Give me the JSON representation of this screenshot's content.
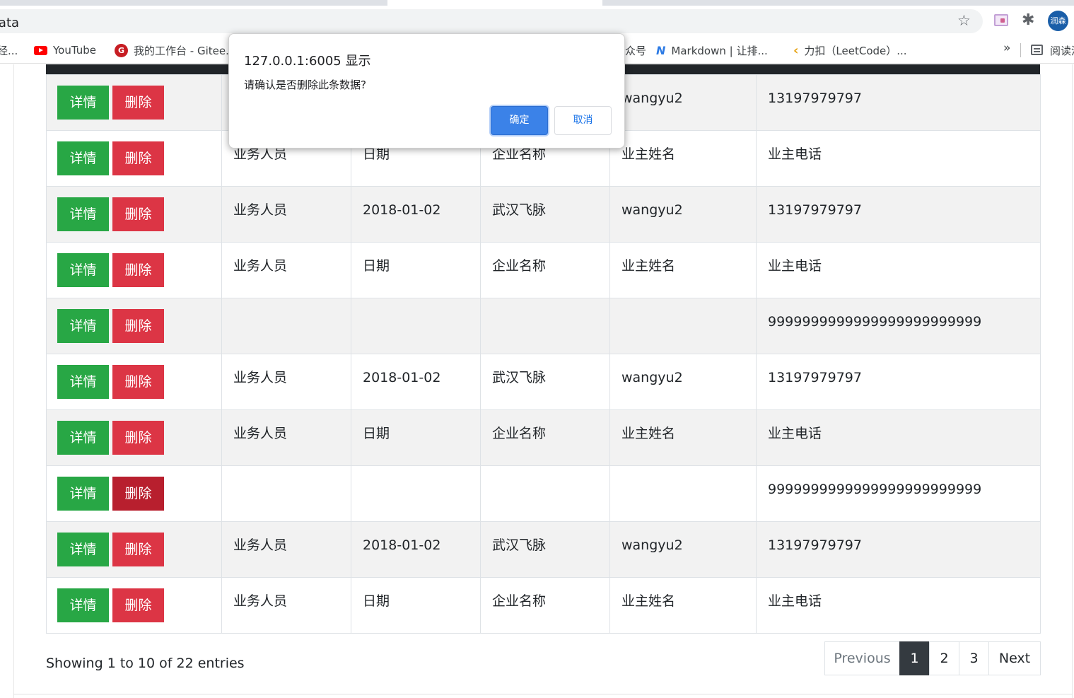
{
  "browser": {
    "url": "-data",
    "avatar_text": "润森",
    "bookmarks": [
      {
        "label": "经..."
      },
      {
        "label": "YouTube"
      },
      {
        "label": "我的工作台 - Gitee."
      },
      {
        "label": "众号"
      },
      {
        "label": "Markdown | 让排..."
      },
      {
        "label": "力扣（LeetCode）..."
      }
    ],
    "more_bookmarks": "»",
    "reading_list": "阅读清"
  },
  "dialog": {
    "title": "127.0.0.1:6005 显示",
    "message": "请确认是否删除此条数据?",
    "ok_label": "确定",
    "cancel_label": "取消"
  },
  "table": {
    "detail_label": "详情",
    "delete_label": "删除",
    "rows": [
      [
        "",
        "",
        "",
        "wangyu2",
        "13197979797"
      ],
      [
        "业务人员",
        "日期",
        "企业名称",
        "业主姓名",
        "业主电话"
      ],
      [
        "业务人员",
        "2018-01-02",
        "武汉飞脉",
        "wangyu2",
        "13197979797"
      ],
      [
        "业务人员",
        "日期",
        "企业名称",
        "业主姓名",
        "业主电话"
      ],
      [
        "",
        "",
        "",
        "",
        "9999999999999999999999999"
      ],
      [
        "业务人员",
        "2018-01-02",
        "武汉飞脉",
        "wangyu2",
        "13197979797"
      ],
      [
        "业务人员",
        "日期",
        "企业名称",
        "业主姓名",
        "业主电话"
      ],
      [
        "",
        "",
        "",
        "",
        "9999999999999999999999999"
      ],
      [
        "业务人员",
        "2018-01-02",
        "武汉飞脉",
        "wangyu2",
        "13197979797"
      ],
      [
        "业务人员",
        "日期",
        "企业名称",
        "业主姓名",
        "业主电话"
      ]
    ]
  },
  "footer": {
    "info": "Showing 1 to 10 of 22 entries",
    "pagination": {
      "previous": "Previous",
      "pages": [
        "1",
        "2",
        "3"
      ],
      "next": "Next",
      "active_page": "1"
    }
  },
  "colors": {
    "detail_button": "#28a745",
    "delete_button": "#dc3545",
    "header_bar": "#212529",
    "dialog_ok": "#3b82e8"
  }
}
